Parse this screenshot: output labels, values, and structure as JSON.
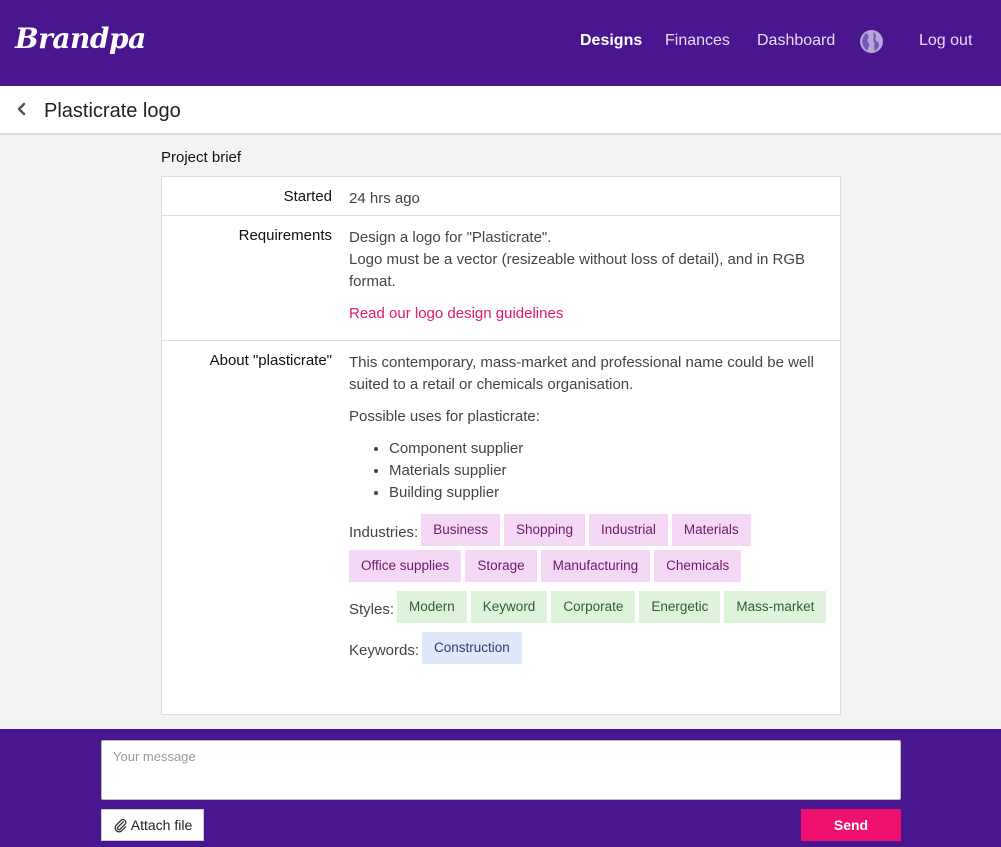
{
  "nav": {
    "logo": "Brandpa",
    "links": [
      "Designs",
      "Finances",
      "Dashboard"
    ],
    "language_icon": "globe-icon",
    "logout": "Log out"
  },
  "title_bar": {
    "back_icon": "chevron-left-icon",
    "title": "Plasticrate logo"
  },
  "brief": {
    "section_title": "Project brief",
    "started_label": "Started",
    "started_value": "24 hrs ago",
    "requirements_label": "Requirements",
    "requirements_lines": [
      "Design a logo for \"Plasticrate\".",
      "Logo must be a vector (resizeable without loss of detail), and in RGB format."
    ],
    "guidelines_link": "Read our logo design guidelines",
    "about_label": "About \"plasticrate\"",
    "about_text": "This contemporary, mass-market and professional name could be well suited to a retail or chemicals organisation.",
    "uses_intro": "Possible uses for plasticrate:",
    "uses": [
      "Component supplier",
      "Materials supplier",
      "Building supplier"
    ],
    "industries_label": "Industries:",
    "industries": [
      "Business",
      "Shopping",
      "Industrial",
      "Materials",
      "Office supplies",
      "Storage",
      "Manufacturing",
      "Chemicals"
    ],
    "styles_label": "Styles:",
    "styles": [
      "Modern",
      "Keyword",
      "Corporate",
      "Energetic",
      "Mass-market"
    ],
    "keywords_label": "Keywords:",
    "keywords": [
      "Construction"
    ]
  },
  "composer": {
    "placeholder": "Your message",
    "attach_label": "Attach file",
    "attach_icon": "paperclip-icon",
    "send_label": "Send"
  },
  "colors": {
    "brand_purple": "#4a168f",
    "accent_pink": "#f0106f",
    "link_pink": "#e0176f"
  }
}
